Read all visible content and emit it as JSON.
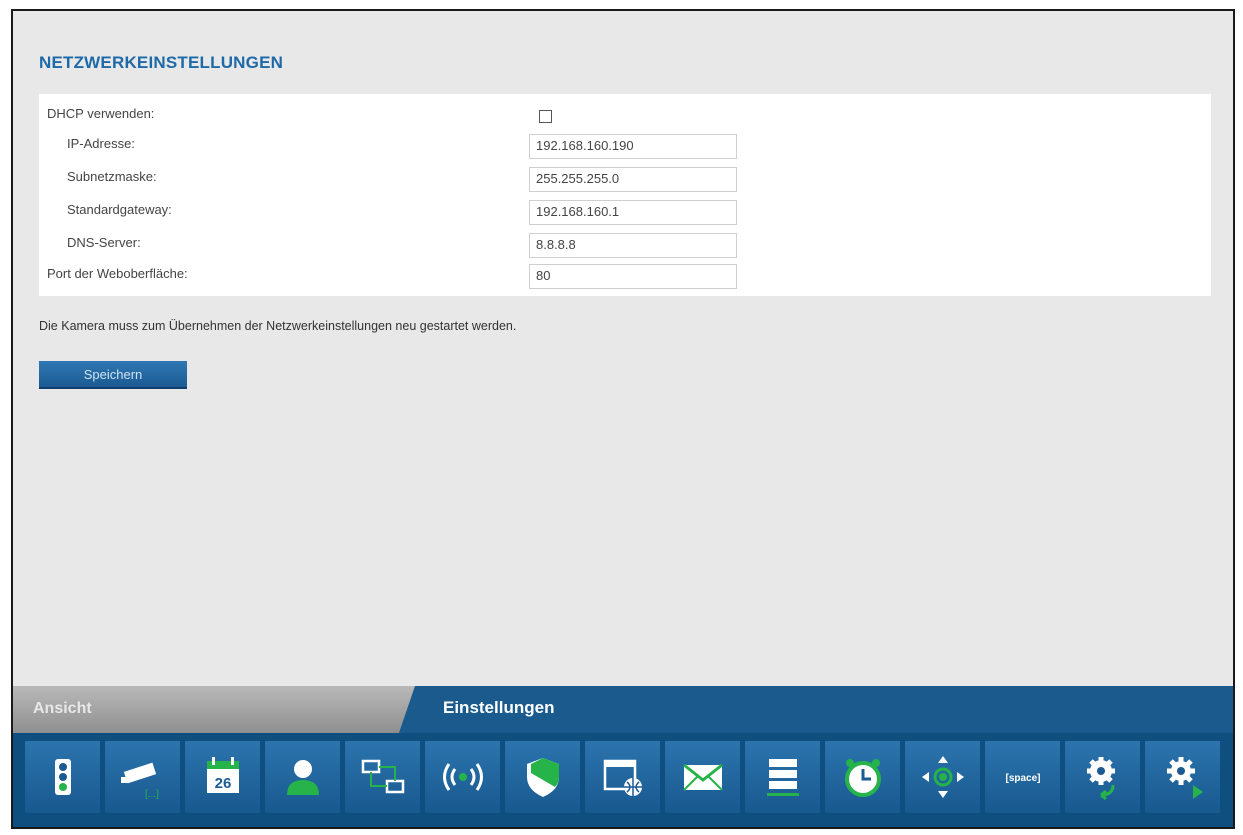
{
  "page_title": "NETZWERKEINSTELLUNGEN",
  "form": {
    "dhcp_label": "DHCP verwenden:",
    "ip_label": "IP-Adresse:",
    "ip_value": "192.168.160.190",
    "subnet_label": "Subnetzmaske:",
    "subnet_value": "255.255.255.0",
    "gateway_label": "Standardgateway:",
    "gateway_value": "192.168.160.1",
    "dns_label": "DNS-Server:",
    "dns_value": "8.8.8.8",
    "port_label": "Port der Weboberfläche:",
    "port_value": "80"
  },
  "note": "Die Kamera muss zum Übernehmen der Netzwerkeinstellungen neu gestartet werden.",
  "save_label": "Speichern",
  "tabs": {
    "ansicht": "Ansicht",
    "einstellungen": "Einstellungen"
  },
  "calendar_day": "26",
  "space_label": "[space]",
  "colors": {
    "accent_blue": "#1c5a92",
    "icon_green": "#25b34a",
    "title_blue": "#1e6aa8"
  }
}
